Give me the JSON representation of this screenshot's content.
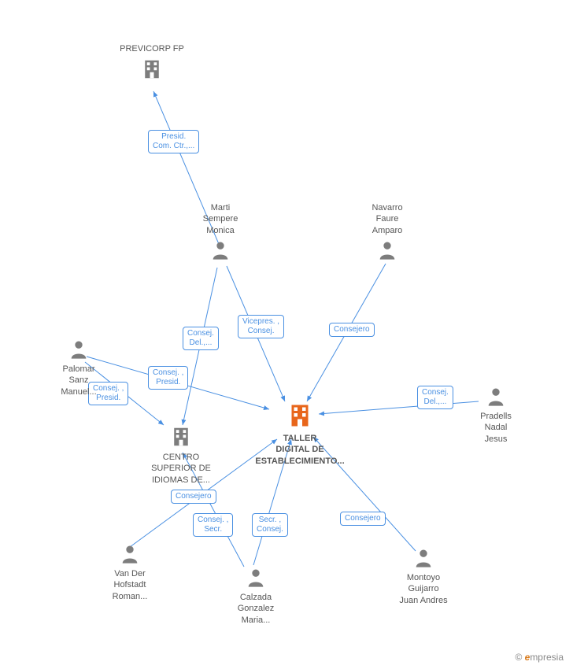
{
  "colors": {
    "edge": "#4a90e2",
    "personFill": "#7d7d7d",
    "buildingGrey": "#7d7d7d",
    "buildingOrange": "#e8661b"
  },
  "companies": {
    "previcorp": {
      "label": "PREVICORP FP"
    },
    "centro": {
      "label": "CENTRO\nSUPERIOR DE\nIDIOMAS DE..."
    },
    "taller": {
      "label": "TALLER\nDIGITAL DE\nESTABLECIMIENTO..."
    }
  },
  "people": {
    "marti": {
      "label": "Marti\nSempere\nMonica"
    },
    "navarro": {
      "label": "Navarro\nFaure\nAmparo"
    },
    "palomar": {
      "label": "Palomar\nSanz\nManuel..."
    },
    "pradells": {
      "label": "Pradells\nNadal\nJesus"
    },
    "vander": {
      "label": "Van Der\nHofstadt\nRoman..."
    },
    "calzada": {
      "label": "Calzada\nGonzalez\nMaria..."
    },
    "montoyo": {
      "label": "Montoyo\nGuijarro\nJuan Andres"
    }
  },
  "edgeLabels": {
    "presidComCtr": "Presid.\nCom. Ctr.,...",
    "vicepresConsej": "Vicepres. ,\nConsej.",
    "consejero1": "Consejero",
    "consejDel1": "Consej.\nDel.,...",
    "consejPresid1": "Consej. ,\nPresid.",
    "consejPresid2": "Consej. ,\nPresid.",
    "consejDel2": "Consej.\nDel.,...",
    "consejero2": "Consejero",
    "consejSecr": "Consej. ,\nSecr.",
    "secrConsej": "Secr. ,\nConsej.",
    "consejero3": "Consejero"
  },
  "watermark": {
    "prefix": "© ",
    "brand1": "e",
    "brand2": "mpresia"
  }
}
